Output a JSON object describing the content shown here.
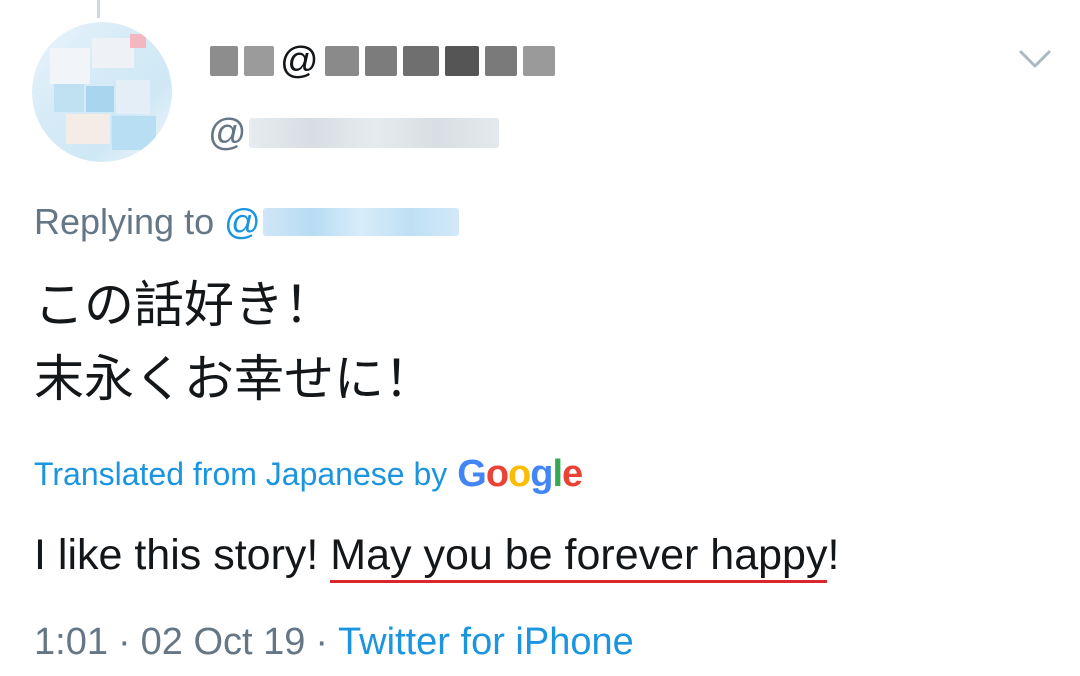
{
  "tweet": {
    "display_name": "りと@り",
    "handle_prefix": "@",
    "reply_label": "Replying to",
    "reply_mention_prefix": "@",
    "text_line1": "この話好き！",
    "text_line2": "末永くお幸せに！",
    "translated_label": "Translated from Japanese by",
    "translation_brand": "Google",
    "translation_plain": "I like this story! ",
    "translation_underlined": "May you be forever happy",
    "translation_end": "!",
    "time": "1:01",
    "date": "02 Oct 19",
    "separator": "·",
    "source": "Twitter for iPhone"
  },
  "icons": {
    "more": "chevron-down-icon",
    "avatar": "avatar-image"
  },
  "colors": {
    "link": "#1b95e0",
    "secondary_text": "#657786",
    "primary_text": "#14171a",
    "underline": "#d9272e"
  }
}
